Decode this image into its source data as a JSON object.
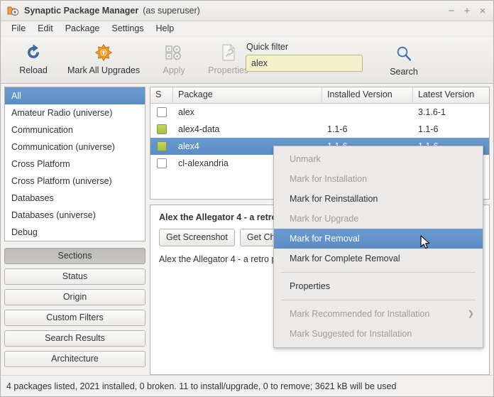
{
  "window": {
    "title": "Synaptic Package Manager",
    "title_suffix": "(as superuser)",
    "app_icon": "package-manager-icon",
    "minimize": "−",
    "maximize": "+",
    "close": "×"
  },
  "menubar": {
    "items": [
      {
        "label": "File"
      },
      {
        "label": "Edit"
      },
      {
        "label": "Package"
      },
      {
        "label": "Settings"
      },
      {
        "label": "Help"
      }
    ]
  },
  "toolbar": {
    "buttons": [
      {
        "label": "Reload",
        "icon": "reload-icon",
        "disabled": false
      },
      {
        "label": "Mark All Upgrades",
        "icon": "upgrades-icon",
        "disabled": false
      },
      {
        "label": "Apply",
        "icon": "apply-icon",
        "disabled": true
      },
      {
        "label": "Properties",
        "icon": "properties-icon",
        "disabled": true
      }
    ],
    "quick_filter": {
      "label": "Quick filter",
      "value": "alex",
      "placeholder": ""
    },
    "search": {
      "label": "Search",
      "icon": "search-icon"
    }
  },
  "sidebar": {
    "categories": [
      {
        "label": "All",
        "selected": true
      },
      {
        "label": "Amateur Radio (universe)",
        "selected": false
      },
      {
        "label": "Communication",
        "selected": false
      },
      {
        "label": "Communication (universe)",
        "selected": false
      },
      {
        "label": "Cross Platform",
        "selected": false
      },
      {
        "label": "Cross Platform (universe)",
        "selected": false
      },
      {
        "label": "Databases",
        "selected": false
      },
      {
        "label": "Databases (universe)",
        "selected": false
      },
      {
        "label": "Debug",
        "selected": false
      }
    ],
    "filter_buttons": [
      {
        "label": "Sections",
        "active": true
      },
      {
        "label": "Status",
        "active": false
      },
      {
        "label": "Origin",
        "active": false
      },
      {
        "label": "Custom Filters",
        "active": false
      },
      {
        "label": "Search Results",
        "active": false
      },
      {
        "label": "Architecture",
        "active": false
      }
    ]
  },
  "package_list": {
    "columns": [
      "S",
      "Package",
      "Installed Version",
      "Latest Version"
    ],
    "rows": [
      {
        "state": "unchecked",
        "package": "alex",
        "installed": "",
        "latest": "3.1.6-1",
        "selected": false
      },
      {
        "state": "installed",
        "package": "alex4-data",
        "installed": "1.1-6",
        "latest": "1.1-6",
        "selected": false
      },
      {
        "state": "installed",
        "package": "alex4",
        "installed": "1.1-6",
        "latest": "1.1-6",
        "selected": true
      },
      {
        "state": "unchecked",
        "package": "cl-alexandria",
        "installed": "",
        "latest": "",
        "selected": false
      }
    ]
  },
  "details": {
    "title": "Alex the Allegator 4 - a retro",
    "buttons": [
      {
        "label": "Get Screenshot"
      },
      {
        "label": "Get Changelog"
      }
    ],
    "description": "Alex the Allegator 4 - a retro pl"
  },
  "context_menu": {
    "items": [
      {
        "label": "Unmark",
        "state": "disabled"
      },
      {
        "label": "Mark for Installation",
        "state": "disabled"
      },
      {
        "label": "Mark for Reinstallation",
        "state": "normal"
      },
      {
        "label": "Mark for Upgrade",
        "state": "disabled"
      },
      {
        "label": "Mark for Removal",
        "state": "highlighted"
      },
      {
        "label": "Mark for Complete Removal",
        "state": "normal"
      },
      {
        "label": "__separator__",
        "state": "separator"
      },
      {
        "label": "Properties",
        "state": "normal"
      },
      {
        "label": "__separator__",
        "state": "separator"
      },
      {
        "label": "Mark Recommended for Installation",
        "state": "disabled",
        "submenu": true
      },
      {
        "label": "Mark Suggested for Installation",
        "state": "disabled"
      }
    ]
  },
  "statusbar": {
    "text": "4 packages listed, 2021 installed, 0 broken. 11 to install/upgrade, 0 to remove; 3621 kB will be used"
  },
  "colors": {
    "selection_blue": "#5b8cc4",
    "installed_green": "#a6c231",
    "filter_field_yellow": "#f3f2cc",
    "window_bg": "#f2f1f0"
  }
}
